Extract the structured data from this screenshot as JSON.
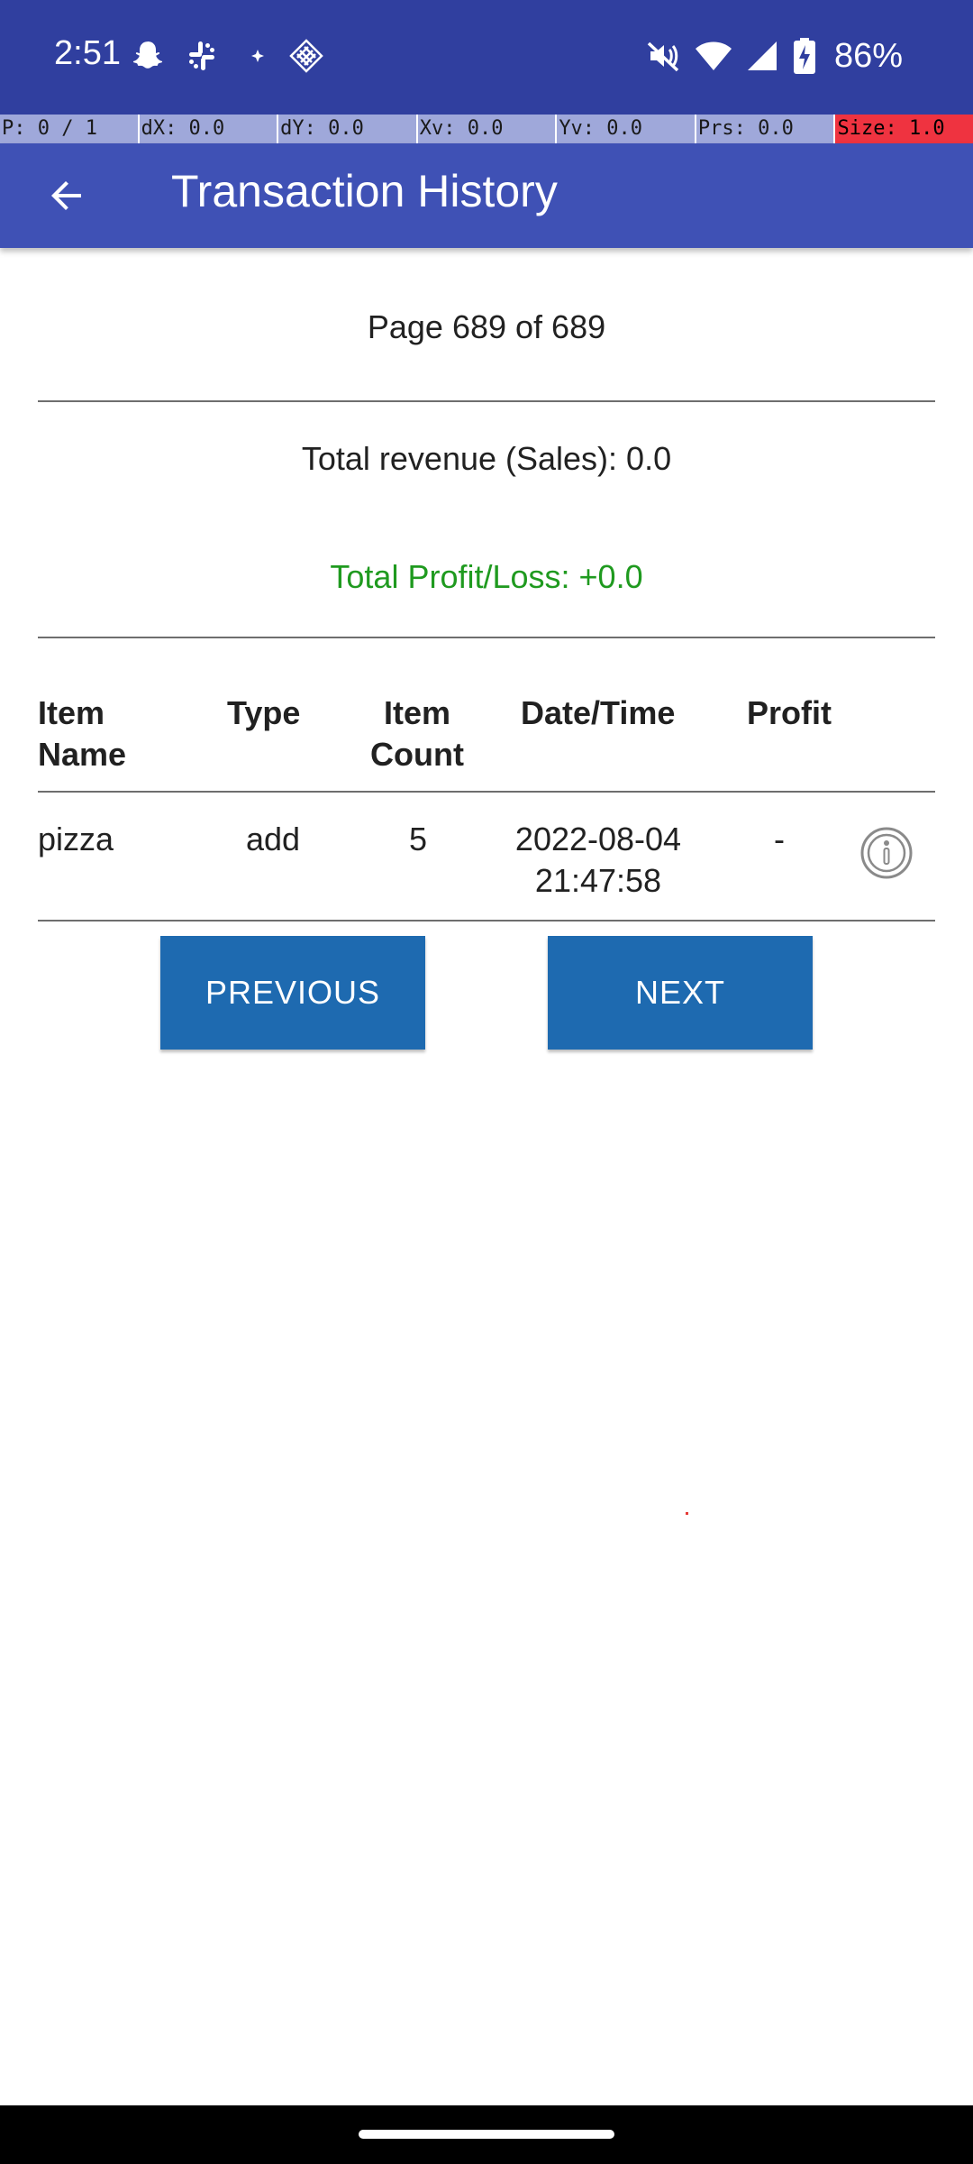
{
  "status_bar": {
    "time": "2:51",
    "battery_percent": "86%",
    "icons": [
      "snapchat-icon",
      "slack-icon",
      "sparkle-icon",
      "grid-diamond-icon",
      "mute-icon",
      "wifi-icon",
      "signal-icon",
      "battery-charging-icon"
    ]
  },
  "pointer_overlay": {
    "p": "P: 0 / 1",
    "dx": "dX: 0.0",
    "dy": "dY: 0.0",
    "xv": "Xv: 0.0",
    "yv": "Yv: 0.0",
    "prs": "Prs: 0.0",
    "size": "Size: 1.0"
  },
  "app_bar": {
    "title": "Transaction History",
    "back_icon": "arrow-back-icon"
  },
  "page_indicator": "Page 689 of 689",
  "summary": {
    "revenue": "Total revenue (Sales): 0.0",
    "profit": "Total Profit/Loss: +0.0"
  },
  "table": {
    "headers": {
      "item_name_1": "Item",
      "item_name_2": "Name",
      "type": "Type",
      "item_count_1": "Item",
      "item_count_2": "Count",
      "datetime": "Date/Time",
      "profit": "Profit"
    },
    "rows": [
      {
        "item_name": "pizza",
        "type": "add",
        "count": "5",
        "date": "2022-08-04",
        "time": "21:47:58",
        "profit": "-"
      }
    ]
  },
  "buttons": {
    "previous": "PREVIOUS",
    "next": "NEXT"
  },
  "colors": {
    "status_bar": "#303f9f",
    "app_bar": "#3f51b5",
    "profit_text": "#1f9a1f",
    "button": "#1e6ab0"
  }
}
